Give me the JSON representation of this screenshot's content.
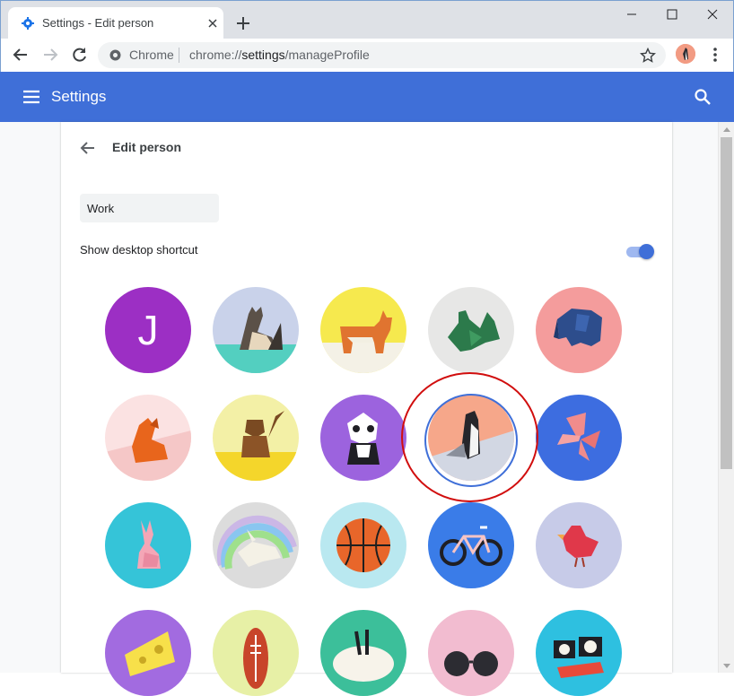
{
  "window": {
    "tab_title": "Settings - Edit person",
    "favicon_icon": "gear-icon",
    "controls": [
      "minimize-icon",
      "maximize-icon",
      "close-icon"
    ]
  },
  "toolbar": {
    "omnibox_chip": "Chrome",
    "url_scheme": "chrome://",
    "url_host": "settings",
    "url_path": "/manageProfile"
  },
  "header": {
    "title": "Settings",
    "color": "#3f6fd8"
  },
  "edit_person": {
    "title": "Edit person",
    "name_value": "Work",
    "shortcut_label": "Show desktop shortcut",
    "shortcut_enabled": true
  },
  "avatars": {
    "selected": "penguin",
    "letter_avatar": "J",
    "items": [
      "J",
      "cat",
      "corgi",
      "dragon",
      "elephant",
      "fox",
      "monkey",
      "panda",
      "penguin",
      "butterfly",
      "rabbit",
      "unicorn",
      "basketball",
      "bike",
      "bird",
      "cheese",
      "football",
      "ramen",
      "sunglasses",
      "sushi"
    ]
  }
}
